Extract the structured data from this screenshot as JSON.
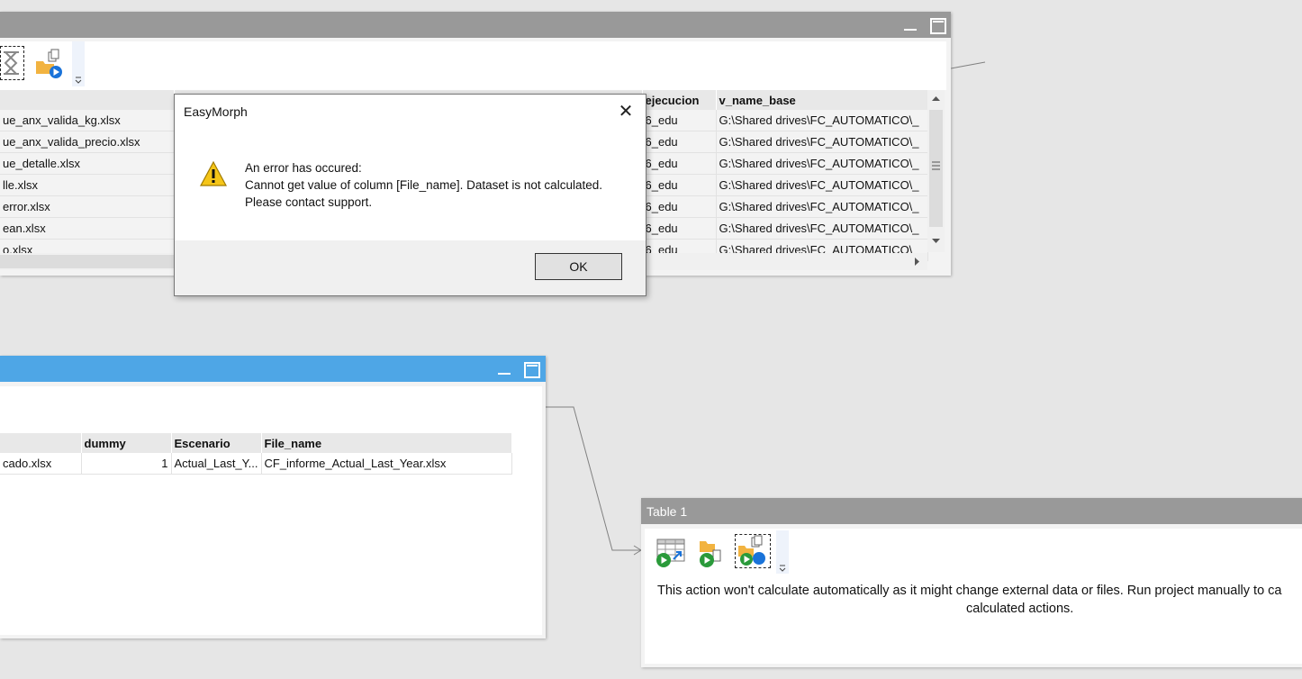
{
  "top_panel": {
    "columns": [
      "",
      "",
      "ejecucion",
      "v_name_base"
    ],
    "rows": [
      [
        "ue_anx_valida_kg.xlsx",
        "",
        "6_edu",
        "G:\\Shared drives\\FC_AUTOMATICO\\_"
      ],
      [
        "ue_anx_valida_precio.xlsx",
        "",
        "6_edu",
        "G:\\Shared drives\\FC_AUTOMATICO\\_"
      ],
      [
        "ue_detalle.xlsx",
        "",
        "6_edu",
        "G:\\Shared drives\\FC_AUTOMATICO\\_"
      ],
      [
        "lle.xlsx",
        "",
        "6_edu",
        "G:\\Shared drives\\FC_AUTOMATICO\\_"
      ],
      [
        "error.xlsx",
        "",
        "6_edu",
        "G:\\Shared drives\\FC_AUTOMATICO\\_"
      ],
      [
        "ean.xlsx",
        "",
        "6_edu",
        "G:\\Shared drives\\FC_AUTOMATICO\\_"
      ],
      [
        "o.xlsx",
        "",
        "6_edu",
        "G:\\Shared drives\\FC_AUTOMATICO\\_"
      ]
    ]
  },
  "left_panel": {
    "columns": [
      "",
      "dummy",
      "Escenario",
      "File_name"
    ],
    "rows": [
      [
        "cado.xlsx",
        "1",
        "Actual_Last_Y...",
        "CF_informe_Actual_Last_Year.xlsx"
      ]
    ]
  },
  "table1_panel": {
    "title": "Table 1",
    "message_line1": "This action won't calculate automatically as it might change external data or files. Run project manually to ca",
    "message_line2": "calculated actions."
  },
  "dialog": {
    "title": "EasyMorph",
    "line1": "An error has occured:",
    "line2": "Cannot get value of column [File_name]. Dataset is not calculated.",
    "line3": "Please contact support.",
    "ok_label": "OK",
    "icon": "warning-icon"
  },
  "colors": {
    "gray_titlebar": "#999999",
    "blue_titlebar": "#4ea6e6",
    "canvas": "#e6e6e6"
  }
}
